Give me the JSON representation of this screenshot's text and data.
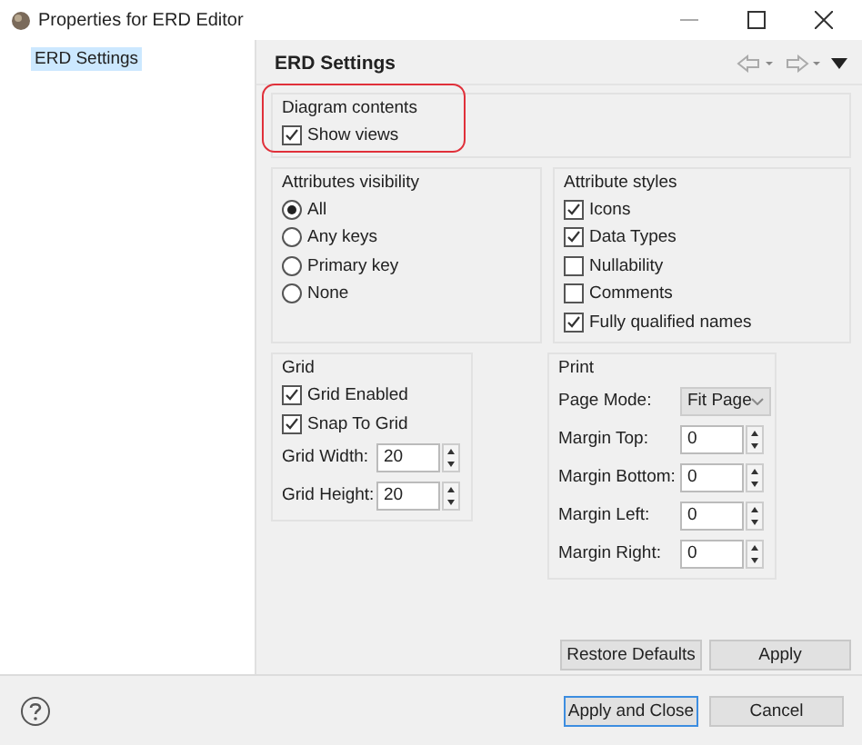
{
  "window": {
    "title": "Properties for ERD Editor"
  },
  "sidebar": {
    "items": [
      {
        "label": "ERD Settings",
        "selected": true
      }
    ]
  },
  "page": {
    "title": "ERD Settings"
  },
  "diagram_contents": {
    "title": "Diagram contents",
    "options": [
      {
        "label": "Show views",
        "checked": true
      }
    ]
  },
  "attributes_visibility": {
    "title": "Attributes visibility",
    "options": [
      {
        "label": "All",
        "selected": true
      },
      {
        "label": "Any keys",
        "selected": false
      },
      {
        "label": "Primary key",
        "selected": false
      },
      {
        "label": "None",
        "selected": false
      }
    ]
  },
  "attribute_styles": {
    "title": "Attribute styles",
    "options": [
      {
        "label": "Icons",
        "checked": true
      },
      {
        "label": "Data Types",
        "checked": true
      },
      {
        "label": "Nullability",
        "checked": false
      },
      {
        "label": "Comments",
        "checked": false
      },
      {
        "label": "Fully qualified names",
        "checked": true
      }
    ]
  },
  "grid": {
    "title": "Grid",
    "options": [
      {
        "label": "Grid Enabled",
        "checked": true
      },
      {
        "label": "Snap To Grid",
        "checked": true
      }
    ],
    "fields": [
      {
        "label": "Grid Width:",
        "value": "20"
      },
      {
        "label": "Grid Height:",
        "value": "20"
      }
    ]
  },
  "print": {
    "title": "Print",
    "page_mode": {
      "label": "Page Mode:",
      "value": "Fit Page"
    },
    "fields": [
      {
        "label": "Margin Top:",
        "value": "0"
      },
      {
        "label": "Margin Bottom:",
        "value": "0"
      },
      {
        "label": "Margin Left:",
        "value": "0"
      },
      {
        "label": "Margin Right:",
        "value": "0"
      }
    ]
  },
  "page_buttons": [
    "Restore Defaults",
    "Apply"
  ],
  "dialog_buttons": [
    {
      "label": "Apply and Close",
      "default": true
    },
    {
      "label": "Cancel",
      "default": false
    }
  ]
}
